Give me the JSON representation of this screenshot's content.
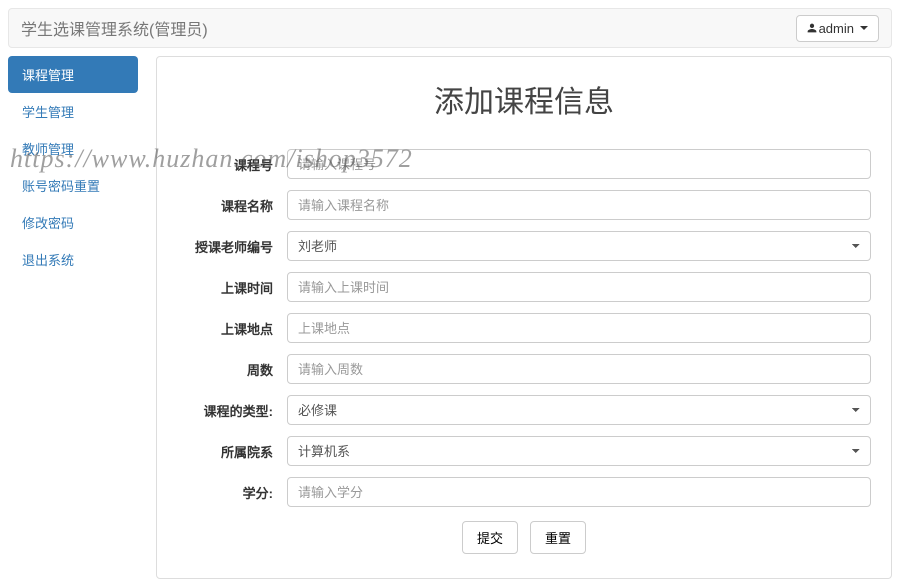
{
  "navbar": {
    "brand": "学生选课管理系统(管理员)",
    "user_label": "admin"
  },
  "sidebar": {
    "items": [
      {
        "label": "课程管理",
        "active": true
      },
      {
        "label": "学生管理",
        "active": false
      },
      {
        "label": "教师管理",
        "active": false
      },
      {
        "label": "账号密码重置",
        "active": false
      },
      {
        "label": "修改密码",
        "active": false
      },
      {
        "label": "退出系统",
        "active": false
      }
    ]
  },
  "form": {
    "title": "添加课程信息",
    "course_no": {
      "label": "课程号",
      "placeholder": "请输入课程号",
      "value": ""
    },
    "course_name": {
      "label": "课程名称",
      "placeholder": "请输入课程名称",
      "value": ""
    },
    "teacher": {
      "label": "授课老师编号",
      "selected": "刘老师"
    },
    "class_time": {
      "label": "上课时间",
      "placeholder": "请输入上课时间",
      "value": ""
    },
    "class_place": {
      "label": "上课地点",
      "placeholder": "上课地点",
      "value": ""
    },
    "weeks": {
      "label": "周数",
      "placeholder": "请输入周数",
      "value": ""
    },
    "course_type": {
      "label": "课程的类型:",
      "selected": "必修课"
    },
    "college": {
      "label": "所属院系",
      "selected": "计算机系"
    },
    "credit": {
      "label": "学分:",
      "placeholder": "请输入学分",
      "value": ""
    },
    "submit_label": "提交",
    "reset_label": "重置"
  },
  "watermark": "https://www.huzhan.com/ishop3572"
}
